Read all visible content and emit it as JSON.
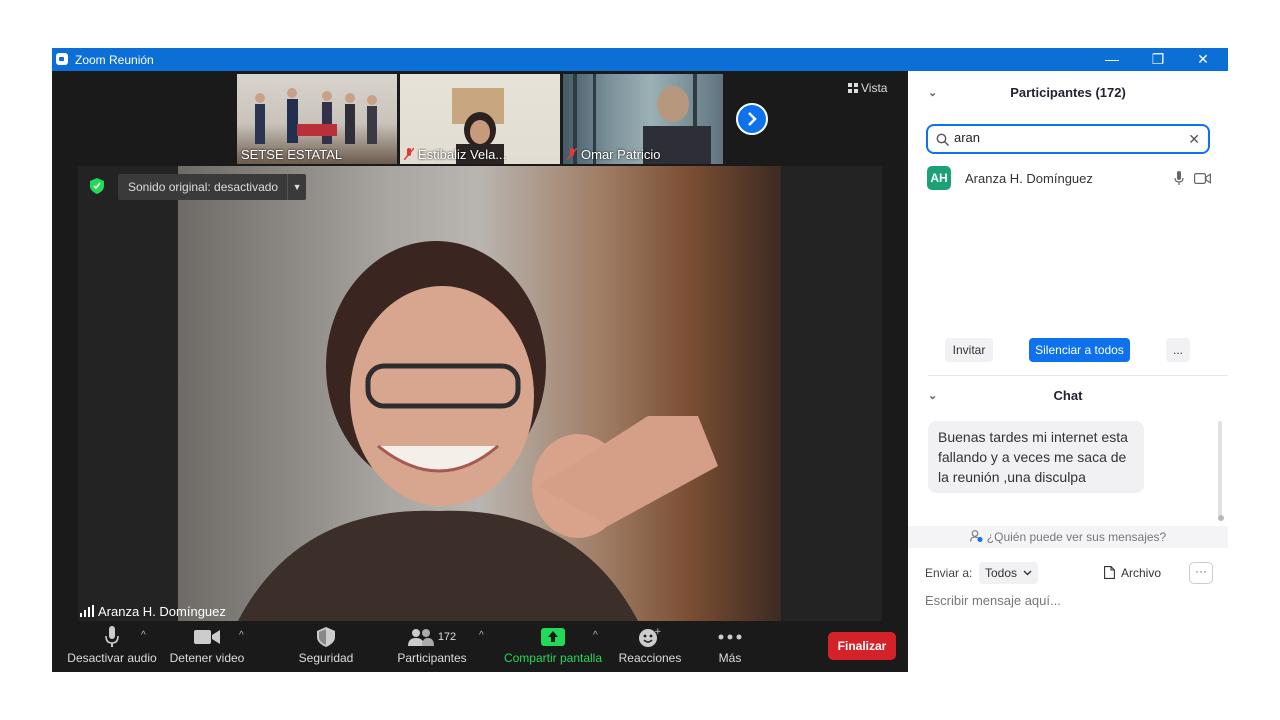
{
  "window": {
    "title": "Zoom Reunión",
    "minimize": "—",
    "restore": "❐",
    "close": "✕"
  },
  "view_button": "Vista",
  "thumbnails": [
    {
      "label": "SETSE ESTATAL",
      "muted": false
    },
    {
      "label": "Estibaliz Vela...",
      "muted": true
    },
    {
      "label": "Omar Patricio",
      "muted": true
    }
  ],
  "main_video": {
    "original_sound": "Sonido original: desactivado",
    "speaker": "Aranza H. Domínguez"
  },
  "toolbar": {
    "audio": "Desactivar audio",
    "video": "Detener video",
    "security": "Seguridad",
    "participants": "Participantes",
    "participants_count": "172",
    "share": "Compartir pantalla",
    "reactions": "Reacciones",
    "more": "Más",
    "end": "Finalizar"
  },
  "participants_panel": {
    "title": "Participantes (172)",
    "search_value": "aran",
    "participant": {
      "initials": "AH",
      "name": "Aranza H. Domínguez",
      "avatar_color": "#1aa177"
    },
    "invite": "Invitar",
    "mute_all": "Silenciar a todos",
    "more": "..."
  },
  "chat_panel": {
    "title": "Chat",
    "message": "Buenas tardes mi internet esta fallando y a veces me saca de la reunión ,una disculpa",
    "visibility": "¿Quién puede ver sus mensajes?",
    "send_to_label": "Enviar a:",
    "send_to_value": "Todos",
    "file": "Archivo",
    "more": "···",
    "input_placeholder": "Escribir mensaje aquí..."
  },
  "colors": {
    "accent": "#0e72ed",
    "end": "#d32329",
    "share_green": "#23d959",
    "titlebar": "#0b6fd6"
  }
}
